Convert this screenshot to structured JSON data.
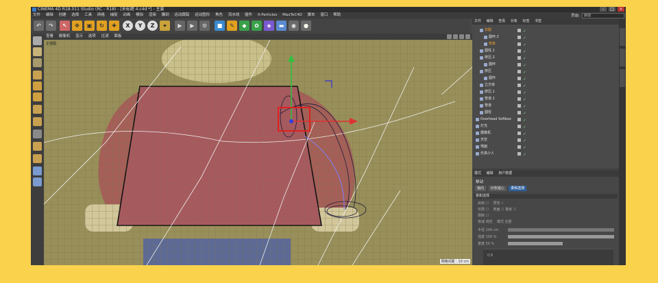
{
  "titlebar": {
    "title": "CINEMA 4D R18.011 Studio (RC - R18) - [未标题 4.c4d *] - 主要"
  },
  "window_controls": [
    "–",
    "□",
    "×"
  ],
  "menubar": {
    "items": [
      "文件",
      "编辑",
      "创建",
      "选择",
      "工具",
      "网格",
      "捕捉",
      "动画",
      "模拟",
      "渲染",
      "雕刻",
      "运动跟踪",
      "运动图形",
      "角色",
      "流水线",
      "插件",
      "X-Particles",
      "MaxToC4D",
      "脚本",
      "窗口",
      "帮助"
    ],
    "layout_label": "界面:",
    "layout_value": "启动"
  },
  "toolbar": {
    "axis_buttons": [
      "X",
      "Y",
      "Z"
    ]
  },
  "viewport": {
    "menu": [
      "查看",
      "摄像机",
      "显示",
      "选项",
      "过滤",
      "面板"
    ],
    "label": "正视图",
    "scale": "网格间距 : 10 cm"
  },
  "object_manager": {
    "menu": [
      "文件",
      "编辑",
      "查看",
      "对象",
      "标签",
      "书签"
    ],
    "objects": [
      {
        "name": "衣服",
        "indent": 1,
        "selected": true
      },
      {
        "name": "圆环.2",
        "indent": 2,
        "selected": false
      },
      {
        "name": "样条",
        "indent": 2,
        "selected": true
      },
      {
        "name": "圆柱.1",
        "indent": 1,
        "selected": false
      },
      {
        "name": "挤压.2",
        "indent": 1,
        "selected": false
      },
      {
        "name": "圆环",
        "indent": 2,
        "selected": false
      },
      {
        "name": "挤压",
        "indent": 1,
        "selected": false
      },
      {
        "name": "圆环",
        "indent": 2,
        "selected": false
      },
      {
        "name": "立方体",
        "indent": 1,
        "selected": false
      },
      {
        "name": "挤压.1",
        "indent": 1,
        "selected": false
      },
      {
        "name": "管道.1",
        "indent": 1,
        "selected": false
      },
      {
        "name": "管道",
        "indent": 1,
        "selected": false
      },
      {
        "name": "圆柱",
        "indent": 1,
        "selected": false
      },
      {
        "name": "Overhead Softbox",
        "indent": 0,
        "selected": false
      },
      {
        "name": "灯光",
        "indent": 0,
        "selected": false
      },
      {
        "name": "摄像机",
        "indent": 0,
        "selected": false
      },
      {
        "name": "天空",
        "indent": 0,
        "selected": false
      },
      {
        "name": "地面",
        "indent": 0,
        "selected": false
      },
      {
        "name": "乐高小人",
        "indent": 0,
        "selected": false
      }
    ]
  },
  "attribute_manager": {
    "menu": [
      "模式",
      "编辑",
      "用户数据"
    ],
    "title": "移动",
    "tabs": [
      "轴向",
      "对象轴心",
      "柔和选择"
    ],
    "active_tab": "柔和选择",
    "section": "柔和选择",
    "rows": [
      {
        "label": "启用 ☐",
        "extra": "预览 ✓"
      },
      {
        "label": "仅限 ☐",
        "extra": "表面 ☐   橡皮 ☐"
      },
      {
        "label": "限制 ☐",
        "extra": ""
      },
      {
        "label": "衰减 线性",
        "extra": "模式 全部"
      },
      {
        "label": "半径 100 cm",
        "extra": ""
      },
      {
        "label": "强度 100 %",
        "extra": ""
      },
      {
        "label": "宽度 50 %",
        "extra": ""
      }
    ],
    "graph_value": "0.8"
  },
  "colors": {
    "background": "#fbd24c",
    "selection": "#f0a030",
    "shirt": "#a85a5e",
    "legs": "#5a6c9a",
    "axis_x": "#e03030",
    "axis_y": "#30c040"
  }
}
